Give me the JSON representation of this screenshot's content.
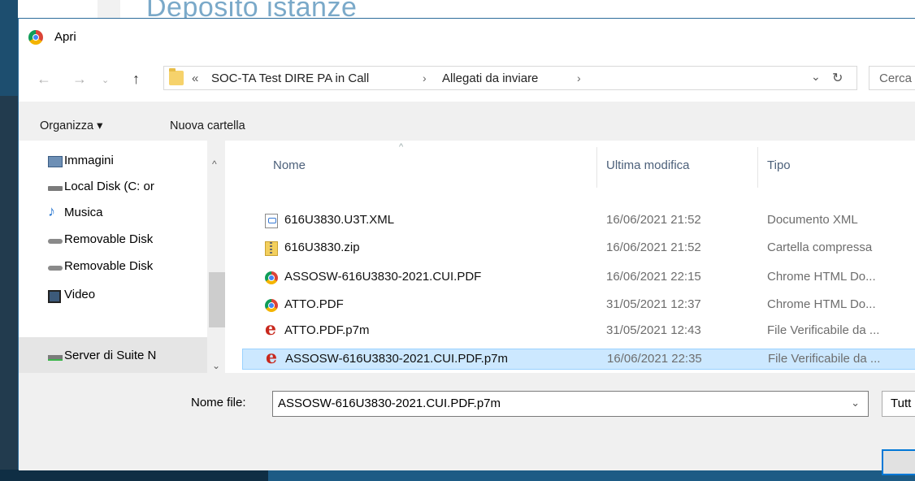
{
  "background": {
    "page_title": "Deposito istanze"
  },
  "dialog": {
    "title": "Apri",
    "address": {
      "overflow": "«",
      "crumbs": [
        "SOC-TA Test DIRE PA in Call",
        "Allegati da inviare"
      ],
      "separator": "›",
      "dropdown": "⌄",
      "refresh": "↻"
    },
    "search_placeholder": "Cerca",
    "toolbar": {
      "organize": "Organizza ▾",
      "new_folder": "Nuova cartella"
    },
    "sidebar": {
      "items": [
        {
          "label": "Immagini",
          "icon": "pictures-icon"
        },
        {
          "label": "Local Disk (C: or",
          "icon": "drive-icon"
        },
        {
          "label": "Musica",
          "icon": "music-icon"
        },
        {
          "label": "Removable Disk",
          "icon": "removable-disk-icon"
        },
        {
          "label": "Removable Disk",
          "icon": "removable-disk-icon"
        },
        {
          "label": "Video",
          "icon": "video-icon"
        },
        {
          "label": "Server di Suite N",
          "icon": "network-drive-icon"
        }
      ]
    },
    "columns": {
      "name": "Nome",
      "modified": "Ultima modifica",
      "type": "Tipo"
    },
    "files": [
      {
        "name": "616U3830.U3T.XML",
        "modified": "16/06/2021 21:52",
        "type": "Documento XML",
        "icon": "xml"
      },
      {
        "name": "616U3830.zip",
        "modified": "16/06/2021 21:52",
        "type": "Cartella compressa",
        "icon": "zip"
      },
      {
        "name": "ASSOSW-616U3830-2021.CUI.PDF",
        "modified": "16/06/2021 22:15",
        "type": "Chrome HTML Do...",
        "icon": "chrome"
      },
      {
        "name": "ATTO.PDF",
        "modified": "31/05/2021 12:37",
        "type": "Chrome HTML Do...",
        "icon": "chrome"
      },
      {
        "name": "ATTO.PDF.p7m",
        "modified": "31/05/2021 12:43",
        "type": "File Verificabile da ...",
        "icon": "e"
      },
      {
        "name": "ASSOSW-616U3830-2021.CUI.PDF.p7m",
        "modified": "16/06/2021 22:35",
        "type": "File Verificabile da ...",
        "icon": "e",
        "selected": true
      }
    ],
    "filename_label": "Nome file:",
    "filename_value": "ASSOSW-616U3830-2021.CUI.PDF.p7m",
    "filetype_value": "Tutt",
    "accent": "#0078d7",
    "selection_color": "#cce8ff"
  }
}
